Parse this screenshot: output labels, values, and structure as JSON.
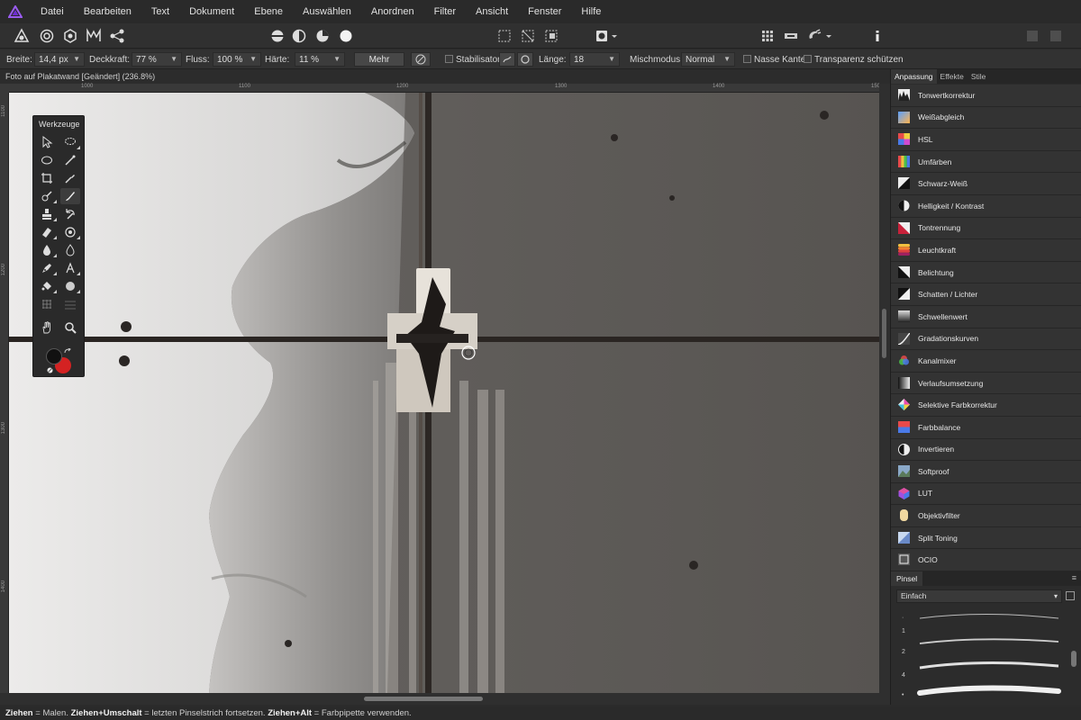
{
  "menubar": {
    "items": [
      "Datei",
      "Bearbeiten",
      "Text",
      "Dokument",
      "Ebene",
      "Auswählen",
      "Anordnen",
      "Filter",
      "Ansicht",
      "Fenster",
      "Hilfe"
    ]
  },
  "context_toolbar": {
    "width_label": "Breite:",
    "width_value": "14,4 px",
    "opacity_label": "Deckkraft:",
    "opacity_value": "77 %",
    "flow_label": "Fluss:",
    "flow_value": "100 %",
    "hardness_label": "Härte:",
    "hardness_value": "11 %",
    "more_label": "Mehr",
    "stabilizer_label": "Stabilisator",
    "length_label": "Länge:",
    "length_value": "18",
    "blend_label": "Mischmodus:",
    "blend_value": "Normal",
    "wet_edges_label": "Nasse Kanten",
    "protect_alpha_label": "Transparenz schützen"
  },
  "document": {
    "title": "Foto auf Plakatwand [Geändert] (236.8%)"
  },
  "rulers": {
    "horizontal": [
      "1000",
      "1100",
      "1200",
      "1300",
      "1400",
      "150"
    ],
    "vertical": [
      "1100",
      "1200",
      "1300",
      "1400"
    ]
  },
  "tools_panel": {
    "title": "Werkzeuge"
  },
  "right_panel": {
    "tabs": [
      "Anpassung",
      "Effekte",
      "Stile"
    ],
    "adjustments": [
      "Tonwertkorrektur",
      "Weißabgleich",
      "HSL",
      "Umfärben",
      "Schwarz-Weiß",
      "Helligkeit / Kontrast",
      "Tontrennung",
      "Leuchtkraft",
      "Belichtung",
      "Schatten / Lichter",
      "Schwellenwert",
      "Gradationskurven",
      "Kanalmixer",
      "Verlaufsumsetzung",
      "Selektive Farbkorrektur",
      "Farbbalance",
      "Invertieren",
      "Softproof",
      "LUT",
      "Objektivfilter",
      "Split Toning",
      "OCIO"
    ]
  },
  "brushes_panel": {
    "tab": "Pinsel",
    "category": "Einfach",
    "brush_numbers": [
      "1",
      "2",
      "4"
    ]
  },
  "status_bar": {
    "k1": "Ziehen",
    "t1": " = Malen. ",
    "k2": "Ziehen+Umschalt",
    "t2": " = letzten Pinselstrich fortsetzen. ",
    "k3": "Ziehen+Alt",
    "t3": " = Farbpipette verwenden."
  },
  "colors": {
    "accent": "#7b3fd6",
    "primary_color": "#111111",
    "secondary_color": "#d42222"
  }
}
